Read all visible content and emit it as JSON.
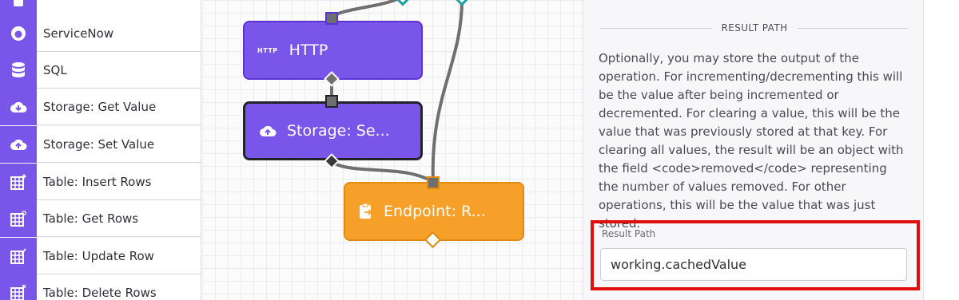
{
  "sidebar": {
    "items": [
      {
        "label": "",
        "icon": "cube-icon"
      },
      {
        "label": "ServiceNow",
        "icon": "servicenow-icon"
      },
      {
        "label": "SQL",
        "icon": "database-icon"
      },
      {
        "label": "Storage: Get Value",
        "icon": "cloud-download-icon"
      },
      {
        "label": "Storage: Set Value",
        "icon": "cloud-upload-icon"
      },
      {
        "label": "Table: Insert Rows",
        "icon": "table-insert-icon"
      },
      {
        "label": "Table: Get Rows",
        "icon": "table-search-icon"
      },
      {
        "label": "Table: Update Row",
        "icon": "table-edit-icon"
      },
      {
        "label": "Table: Delete Rows",
        "icon": "table-delete-icon"
      }
    ]
  },
  "canvas": {
    "nodes": {
      "http": {
        "badge": "HTTP",
        "label": "HTTP",
        "color": "#7a55ea"
      },
      "storage": {
        "label": "Storage: Se...",
        "color": "#7a55ea"
      },
      "endpoint": {
        "label": "Endpoint: R...",
        "color": "#f6a02a"
      }
    },
    "colors": {
      "wire": "#6f6f6f",
      "teal": "#1e9ea0"
    }
  },
  "panel": {
    "section_title": "RESULT PATH",
    "description": "Optionally, you may store the output of the operation. For incrementing/decrementing this will be the value after being incremented or decremented. For clearing a value, this will be the value that was previously stored at that key. For clearing all values, the result will be an object with the field <code>removed</code> representing the number of values removed. For other operations, this will be the value that was just stored.",
    "field_label": "Result Path",
    "field_value": "working.cachedValue",
    "highlight_color": "#e00d0d"
  }
}
